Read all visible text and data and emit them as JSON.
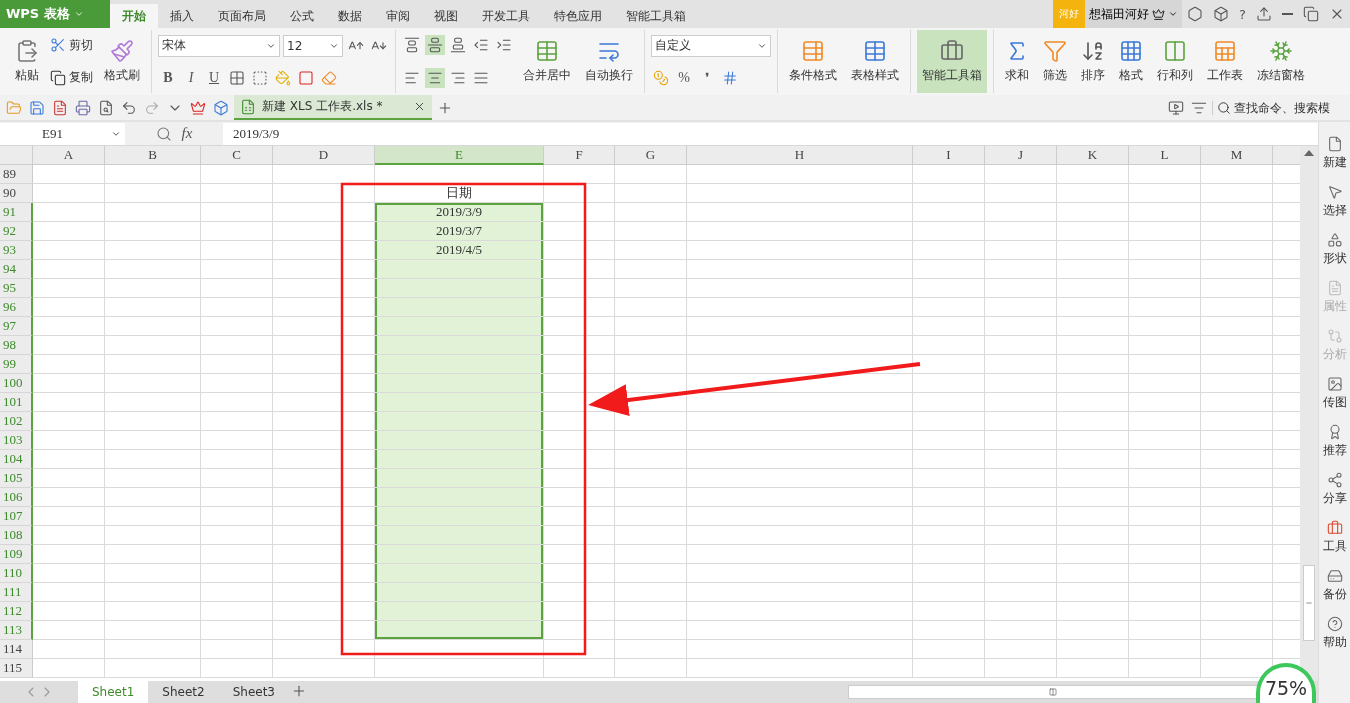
{
  "title_bar": {
    "app_menu": "WPS 表格",
    "tabs": [
      {
        "label": "开始",
        "selected": true
      },
      {
        "label": "插入",
        "selected": false
      },
      {
        "label": "页面布局",
        "selected": false
      },
      {
        "label": "公式",
        "selected": false
      },
      {
        "label": "数据",
        "selected": false
      },
      {
        "label": "审阅",
        "selected": false
      },
      {
        "label": "视图",
        "selected": false
      },
      {
        "label": "开发工具",
        "selected": false
      },
      {
        "label": "特色应用",
        "selected": false
      },
      {
        "label": "智能工具箱",
        "selected": false
      }
    ],
    "user_badge": "河好",
    "user_name": "想福田河好",
    "help": "?"
  },
  "ribbon": {
    "clipboard": {
      "paste": "粘贴",
      "cut": "剪切",
      "copy": "复制",
      "format_painter": "格式刷"
    },
    "font": {
      "name": "宋体",
      "size": "12",
      "bold": "B",
      "italic": "I",
      "underline": "U"
    },
    "vertical_align": [
      {
        "selected": false
      },
      {
        "selected": true
      },
      {
        "selected": false
      }
    ],
    "horizontal_align": [
      {
        "selected": false
      },
      {
        "selected": true
      },
      {
        "selected": false
      },
      {
        "selected": false
      }
    ],
    "merge": "合并居中",
    "wrap": "自动换行",
    "number": {
      "format": "自定义",
      "percent": "%",
      "comma": "❜"
    },
    "styles": [
      {
        "label": "条件格式",
        "selected": false
      },
      {
        "label": "表格样式",
        "selected": false
      }
    ],
    "toolbox": {
      "label": "智能工具箱",
      "selected": true
    },
    "editing": [
      {
        "label": "求和"
      },
      {
        "label": "筛选"
      },
      {
        "label": "排序"
      },
      {
        "label": "格式"
      },
      {
        "label": "行和列"
      },
      {
        "label": "工作表"
      },
      {
        "label": "冻结窗格"
      }
    ]
  },
  "quick_bar": {
    "document": {
      "title": "新建 XLS 工作表.xls *",
      "selected": true
    },
    "search": {
      "placeholder": "查找命令、搜索模"
    }
  },
  "formula_bar": {
    "name_box": "E91",
    "fx_label": "fx",
    "formula": "2019/3/9"
  },
  "sheet": {
    "columns": [
      {
        "label": "A",
        "selected": false
      },
      {
        "label": "B",
        "selected": false
      },
      {
        "label": "C",
        "selected": false
      },
      {
        "label": "D",
        "selected": false
      },
      {
        "label": "E",
        "selected": true
      },
      {
        "label": "F",
        "selected": false
      },
      {
        "label": "G",
        "selected": false
      },
      {
        "label": "H",
        "selected": false
      },
      {
        "label": "I",
        "selected": false
      },
      {
        "label": "J",
        "selected": false
      },
      {
        "label": "K",
        "selected": false
      },
      {
        "label": "L",
        "selected": false
      },
      {
        "label": "M",
        "selected": false
      }
    ],
    "rows": [
      {
        "number": "89",
        "selected": false
      },
      {
        "number": "90",
        "selected": false,
        "value": "日期"
      },
      {
        "number": "91",
        "selected": true,
        "value": "2019/3/9"
      },
      {
        "number": "92",
        "selected": true,
        "value": "2019/3/7"
      },
      {
        "number": "93",
        "selected": true,
        "value": "2019/4/5"
      },
      {
        "number": "94",
        "selected": true
      },
      {
        "number": "95",
        "selected": true
      },
      {
        "number": "96",
        "selected": true
      },
      {
        "number": "97",
        "selected": true
      },
      {
        "number": "98",
        "selected": true
      },
      {
        "number": "99",
        "selected": true
      },
      {
        "number": "100",
        "selected": true
      },
      {
        "number": "101",
        "selected": true
      },
      {
        "number": "102",
        "selected": true
      },
      {
        "number": "103",
        "selected": true
      },
      {
        "number": "104",
        "selected": true
      },
      {
        "number": "105",
        "selected": true
      },
      {
        "number": "106",
        "selected": true
      },
      {
        "number": "107",
        "selected": true
      },
      {
        "number": "108",
        "selected": true
      },
      {
        "number": "109",
        "selected": true
      },
      {
        "number": "110",
        "selected": true
      },
      {
        "number": "111",
        "selected": true
      },
      {
        "number": "112",
        "selected": true
      },
      {
        "number": "113",
        "selected": true
      },
      {
        "number": "114",
        "selected": false
      },
      {
        "number": "115",
        "selected": false
      }
    ]
  },
  "sheet_tabs": [
    {
      "label": "Sheet1",
      "selected": true
    },
    {
      "label": "Sheet2",
      "selected": false
    },
    {
      "label": "Sheet3",
      "selected": false
    }
  ],
  "zoom": "75%",
  "sidebar": [
    {
      "label": "新建",
      "disabled": false
    },
    {
      "label": "选择",
      "disabled": false
    },
    {
      "label": "形状",
      "disabled": false
    },
    {
      "label": "属性",
      "disabled": true
    },
    {
      "label": "分析",
      "disabled": true
    },
    {
      "label": "传图",
      "disabled": false
    },
    {
      "label": "推荐",
      "disabled": false
    },
    {
      "label": "分享",
      "disabled": false
    },
    {
      "label": "工具",
      "disabled": false
    },
    {
      "label": "备份",
      "disabled": false
    },
    {
      "label": "帮助",
      "disabled": false
    }
  ]
}
